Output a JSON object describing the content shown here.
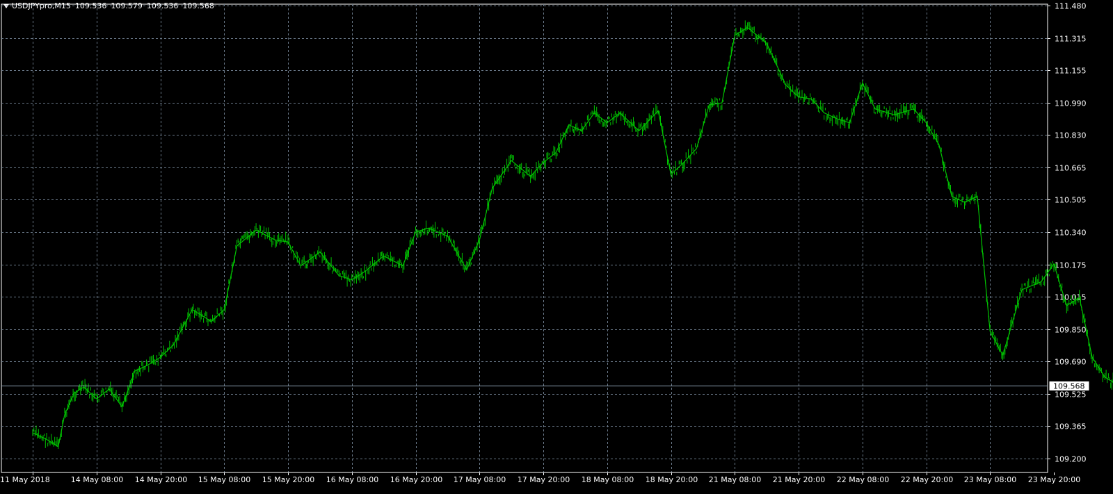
{
  "header": {
    "symbol": "USDJPYpro,M15",
    "open": "109.536",
    "high": "109.579",
    "low": "109.536",
    "close": "109.568"
  },
  "chart_data": {
    "type": "line",
    "title": "",
    "xlabel": "",
    "ylabel": "",
    "ylim": [
      109.2,
      111.48
    ],
    "grid": true,
    "colors": {
      "background": "#000000",
      "series": "#00c400",
      "grid": "#6b7a8a",
      "axis_text": "#ffffff",
      "price_line": "#8fa2b4"
    },
    "y_ticks": [
      "111.480",
      "111.315",
      "111.155",
      "110.990",
      "110.830",
      "110.665",
      "110.505",
      "110.340",
      "110.175",
      "110.015",
      "109.850",
      "109.690",
      "109.525",
      "109.365",
      "109.200"
    ],
    "x_ticks": [
      "11 May 2018",
      "14 May 08:00",
      "14 May 20:00",
      "15 May 08:00",
      "15 May 20:00",
      "16 May 08:00",
      "16 May 20:00",
      "17 May 08:00",
      "17 May 20:00",
      "18 May 08:00",
      "18 May 20:00",
      "21 May 08:00",
      "21 May 20:00",
      "22 May 08:00",
      "22 May 20:00",
      "23 May 08:00",
      "23 May 20:00"
    ],
    "current_price": "109.568",
    "current_value": 109.568,
    "series": [
      {
        "x": [
          0,
          0.2,
          0.4,
          0.5,
          0.65,
          0.8,
          1,
          1.2,
          1.4,
          1.6,
          1.8,
          2,
          2.2,
          2.5,
          2.8,
          3,
          3.2,
          3.5,
          3.8,
          4,
          4.2,
          4.5,
          4.8,
          5,
          5.2,
          5.5,
          5.8,
          6,
          6.2,
          6.5,
          6.8,
          7,
          7.2,
          7.5,
          7.8,
          8,
          8.2,
          8.4,
          8.6,
          8.8,
          9,
          9.2,
          9.5,
          9.8,
          10,
          10.2,
          10.4,
          10.6,
          10.8,
          11,
          11.2,
          11.5,
          11.8,
          12,
          12.2,
          12.4,
          12.6,
          12.8,
          13,
          13.2,
          13.5,
          13.8,
          14,
          14.2,
          14.4,
          14.6,
          14.8,
          15,
          15.2,
          15.5,
          15.8,
          16,
          16.2,
          16.4,
          16.6,
          16.8,
          17
        ],
        "y": [
          109.33,
          109.3,
          109.26,
          109.42,
          109.53,
          109.56,
          109.5,
          109.55,
          109.46,
          109.64,
          109.67,
          109.71,
          109.77,
          109.95,
          109.89,
          109.95,
          110.27,
          110.35,
          110.3,
          110.29,
          110.17,
          110.24,
          110.12,
          110.1,
          110.14,
          110.22,
          110.17,
          110.34,
          110.36,
          110.32,
          110.15,
          110.3,
          110.56,
          110.7,
          110.62,
          110.69,
          110.74,
          110.88,
          110.85,
          110.94,
          110.89,
          110.94,
          110.85,
          110.95,
          110.63,
          110.69,
          110.76,
          110.98,
          110.99,
          111.33,
          111.37,
          111.29,
          111.08,
          111.02,
          111.01,
          110.94,
          110.91,
          110.89,
          111.09,
          110.96,
          110.93,
          110.96,
          110.89,
          110.78,
          110.52,
          110.49,
          110.52,
          109.84,
          109.72,
          110.05,
          110.09,
          110.18,
          109.97,
          110.01,
          109.71,
          109.61,
          109.57
        ]
      }
    ]
  }
}
